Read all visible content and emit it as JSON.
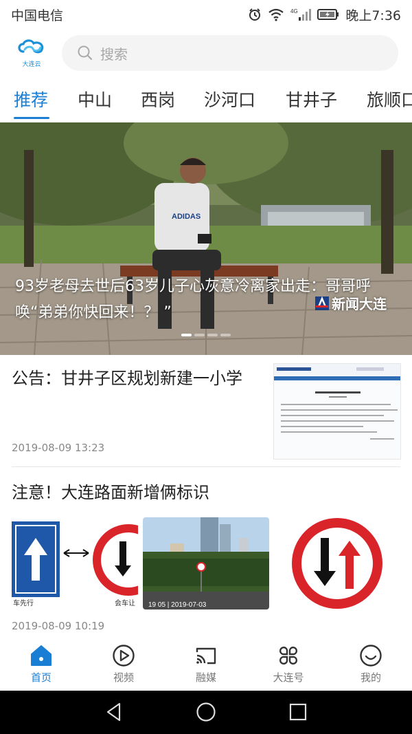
{
  "status_bar": {
    "carrier": "中国电信",
    "network": "4G",
    "time": "晚上7:36"
  },
  "header": {
    "logo_text": "大连云",
    "search_placeholder": "搜索"
  },
  "tabs": [
    {
      "label": "推荐",
      "active": true
    },
    {
      "label": "中山",
      "active": false
    },
    {
      "label": "西岗",
      "active": false
    },
    {
      "label": "沙河口",
      "active": false
    },
    {
      "label": "甘井子",
      "active": false
    },
    {
      "label": "旅顺口",
      "active": false
    }
  ],
  "banner": {
    "title": "93岁老母去世后63岁儿子心灰意冷离家出走：哥哥呼唤“弟弟你快回来！？ ”",
    "shirt_text": "ADIDAS",
    "source_logo": "新闻大连",
    "slide_count": 4,
    "active_slide": 0
  },
  "articles": [
    {
      "title": "公告：甘井子区规划新建一小学",
      "time": "2019-08-09 13:23"
    },
    {
      "title": "注意！大连路面新增俩标识",
      "time": "2019-08-09 10:19",
      "image_captions": [
        "车先行",
        "会车让",
        "19 05 | 2019-07-03"
      ]
    }
  ],
  "bottom_nav": [
    {
      "label": "首页",
      "icon": "home-icon",
      "active": true
    },
    {
      "label": "视频",
      "icon": "play-icon",
      "active": false
    },
    {
      "label": "融媒",
      "icon": "cast-icon",
      "active": false
    },
    {
      "label": "大连号",
      "icon": "grid-icon",
      "active": false
    },
    {
      "label": "我的",
      "icon": "smile-icon",
      "active": false
    }
  ],
  "colors": {
    "accent": "#1a7fd4",
    "inactive_text": "#777777",
    "sign_red": "#d9252a",
    "sign_blue": "#1f58a8"
  }
}
